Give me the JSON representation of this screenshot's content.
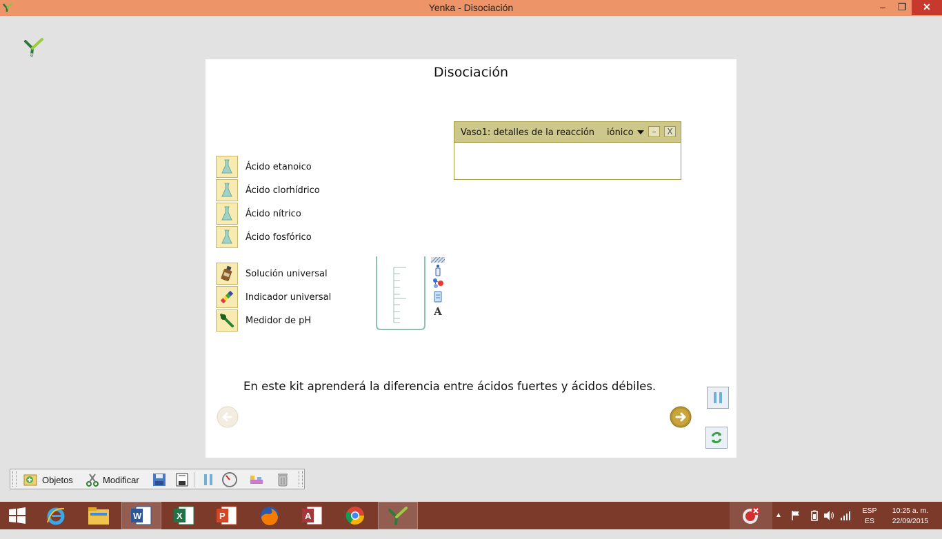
{
  "window": {
    "title": "Yenka - Disociación"
  },
  "page": {
    "title": "Disociación"
  },
  "acids": [
    {
      "label": "Ácido etanoico"
    },
    {
      "label": "Ácido clorhídrico"
    },
    {
      "label": "Ácido nítrico"
    },
    {
      "label": "Ácido fosfórico"
    }
  ],
  "indicators": [
    {
      "label": "Solución universal",
      "icon": "bottle-icon"
    },
    {
      "label": "Indicador universal",
      "icon": "indicator-paper-icon"
    },
    {
      "label": "Medidor de pH",
      "icon": "ph-meter-icon"
    }
  ],
  "reaction_panel": {
    "title": "Vaso1: detalles de la reacción",
    "mode": "iónico",
    "minimize": "–",
    "close": "X"
  },
  "description": "En este kit aprenderá la diferencia entre ácidos fuertes y ácidos débiles.",
  "beaker_tools": {
    "text_tool": "A"
  },
  "toolbar": {
    "objects_label": "Objetos",
    "modify_label": "Modificar"
  },
  "tray": {
    "language": "ESP",
    "layout": "ES",
    "time": "10:25 a. m.",
    "date": "22/09/2015"
  },
  "colors": {
    "titlebar": "#ed9568",
    "taskbar": "#7c3a2b",
    "item_bg": "#f8ebb1",
    "panel_header": "#cdc78c"
  }
}
